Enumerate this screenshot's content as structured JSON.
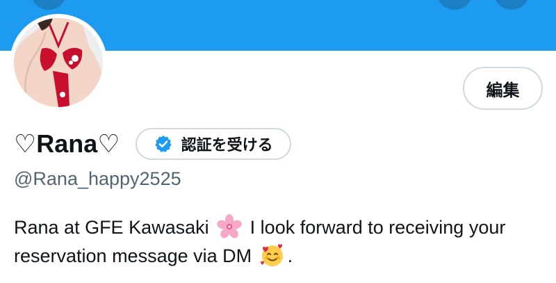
{
  "profile": {
    "display_name": "♡Rana♡",
    "handle": "@Rana_happy2525",
    "bio_part1": "Rana at GFE Kawasaki",
    "bio_part2": "I look forward to receiving your reservation message via DM",
    "bio_part3": ".",
    "bio_emojis": [
      "cherry-blossom",
      "smiling-face-with-hearts"
    ]
  },
  "actions": {
    "edit_label": "編集",
    "verify_label": "認証を受ける"
  },
  "colors": {
    "banner": "#1d9bf0",
    "verified_badge": "#1d9bf0",
    "secondary_text": "#536471",
    "button_border": "#cfd9de"
  }
}
